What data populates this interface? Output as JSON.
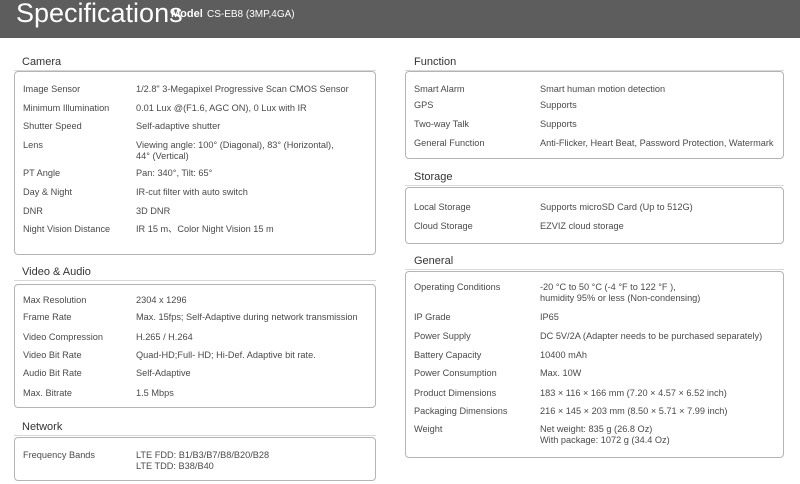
{
  "header": {
    "title": "Specifications",
    "model_label": "Model",
    "model_value": "CS-EB8 (3MP,4GA)"
  },
  "camera": {
    "title": "Camera",
    "rows": [
      {
        "label": "Image Sensor",
        "value": [
          "1/2.8\" 3-Megapixel Progressive Scan CMOS Sensor"
        ]
      },
      {
        "label": "Minimum Illumination",
        "value": [
          "0.01 Lux @(F1.6, AGC ON), 0 Lux with IR"
        ]
      },
      {
        "label": "Shutter Speed",
        "value": [
          "Self-adaptive shutter"
        ]
      },
      {
        "label": "Lens",
        "value": [
          "Viewing angle: 100° (Diagonal), 83° (Horizontal),",
          "44° (Vertical)"
        ]
      },
      {
        "label": "PT Angle",
        "value": [
          "Pan: 340°, Tilt: 65°"
        ]
      },
      {
        "label": "Day & Night",
        "value": [
          "IR-cut filter with auto switch"
        ]
      },
      {
        "label": "DNR",
        "value": [
          "3D DNR"
        ]
      },
      {
        "label": "Night Vision Distance",
        "value": [
          "IR 15 m、Color Night Vision 15 m"
        ]
      }
    ]
  },
  "video_audio": {
    "title": "Video & Audio",
    "rows": [
      {
        "label": "Max Resolution",
        "value": [
          "2304 x 1296"
        ]
      },
      {
        "label": "Frame Rate",
        "value": [
          "Max. 15fps; Self-Adaptive during network transmission"
        ]
      },
      {
        "label": "Video Compression",
        "value": [
          "H.265 / H.264"
        ]
      },
      {
        "label": "Video Bit Rate",
        "value": [
          "Quad-HD;Full- HD; Hi-Def. Adaptive bit rate."
        ]
      },
      {
        "label": "Audio Bit Rate",
        "value": [
          "Self-Adaptive"
        ]
      },
      {
        "label": "Max. Bitrate",
        "value": [
          "1.5 Mbps"
        ]
      }
    ]
  },
  "network": {
    "title": "Network",
    "rows": [
      {
        "label": "Frequency Bands",
        "value": [
          "LTE FDD: B1/B3/B7/B8/B20/B28",
          "LTE TDD: B38/B40"
        ]
      }
    ]
  },
  "function": {
    "title": "Function",
    "rows": [
      {
        "label": "Smart Alarm",
        "value": [
          "Smart human motion detection"
        ]
      },
      {
        "label": "GPS",
        "value": [
          "Supports"
        ]
      },
      {
        "label": "Two-way Talk",
        "value": [
          "Supports"
        ]
      },
      {
        "label": "General Function",
        "value": [
          "Anti-Flicker, Heart Beat, Password Protection, Watermark"
        ]
      }
    ]
  },
  "storage": {
    "title": "Storage",
    "rows": [
      {
        "label": "Local Storage",
        "value": [
          "Supports microSD Card (Up to 512G)"
        ]
      },
      {
        "label": "Cloud Storage",
        "value": [
          "EZVIZ cloud storage"
        ]
      }
    ]
  },
  "general": {
    "title": "General",
    "rows": [
      {
        "label": "Operating Conditions",
        "value": [
          "-20 °C to 50 °C (-4 °F to 122 °F ),",
          "humidity 95% or less (Non-condensing)"
        ]
      },
      {
        "label": "IP Grade",
        "value": [
          "IP65"
        ]
      },
      {
        "label": "Power Supply",
        "value": [
          "DC 5V/2A  (Adapter needs to be purchased separately)"
        ]
      },
      {
        "label": "Battery Capacity",
        "value": [
          "10400 mAh"
        ]
      },
      {
        "label": "Power Consumption",
        "value": [
          "Max. 10W"
        ]
      },
      {
        "label": "Product Dimensions",
        "value": [
          "183 × 116 × 166 mm (7.20 × 4.57 × 6.52 inch)"
        ]
      },
      {
        "label": "Packaging Dimensions",
        "value": [
          "216 × 145 × 203 mm (8.50 × 5.71 × 7.99 inch)"
        ]
      },
      {
        "label": "Weight",
        "value": [
          "Net weight: 835 g (26.8 Oz)",
          "With package: 1072 g (34.4 Oz)"
        ]
      }
    ]
  }
}
